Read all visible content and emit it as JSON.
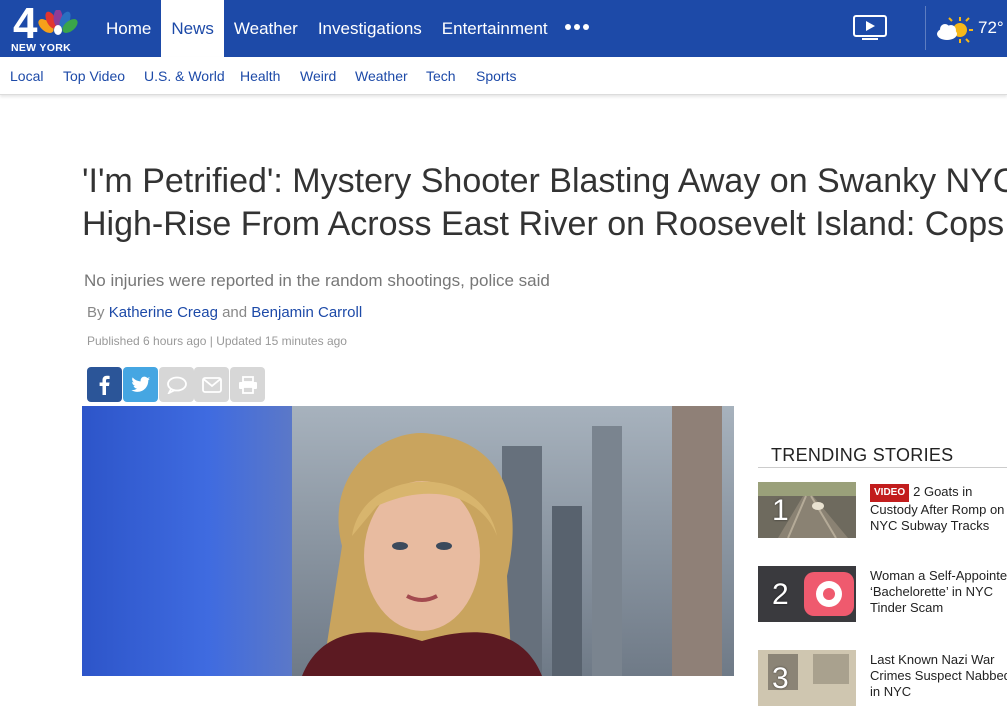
{
  "header": {
    "logo_number": "4",
    "logo_text": "NEW YORK",
    "nav": [
      {
        "label": "Home"
      },
      {
        "label": "News"
      },
      {
        "label": "Weather"
      },
      {
        "label": "Investigations"
      },
      {
        "label": "Entertainment"
      }
    ],
    "active_nav": "News",
    "temperature": "72°"
  },
  "subnav": {
    "items": [
      {
        "label": "Local"
      },
      {
        "label": "Top Video"
      },
      {
        "label": "U.S. & World"
      },
      {
        "label": "Health"
      },
      {
        "label": "Weird"
      },
      {
        "label": "Weather"
      },
      {
        "label": "Tech"
      },
      {
        "label": "Sports"
      }
    ]
  },
  "article": {
    "headline_line1": "'I'm Petrified': Mystery Shooter Blasting Away on Swanky NYC",
    "headline_line2": "High-Rise From Across East River on Roosevelt Island: Cops",
    "subhead": "No injuries were reported in the random shootings, police said",
    "byline_prefix": "By",
    "author1": "Katherine Creag",
    "byline_and": "and",
    "author2": "Benjamin Carroll",
    "published": "Published 6 hours ago | Updated 15 minutes ago"
  },
  "trending": {
    "title": "TRENDING STORIES",
    "items": [
      {
        "rank": "1",
        "badge": "VIDEO",
        "text": "2 Goats in Custody After Romp on NYC Subway Tracks"
      },
      {
        "rank": "2",
        "badge": "",
        "text": "Woman a Self-Appointed ‘Bachelorette’ in NYC Tinder Scam"
      },
      {
        "rank": "3",
        "badge": "",
        "text": "Last Known Nazi War Crimes Suspect Nabbed in NYC"
      }
    ]
  },
  "colors": {
    "brand_blue": "#1d4aa8",
    "facebook": "#2b5598",
    "twitter": "#45a6e2",
    "video_badge": "#c21d1d"
  }
}
